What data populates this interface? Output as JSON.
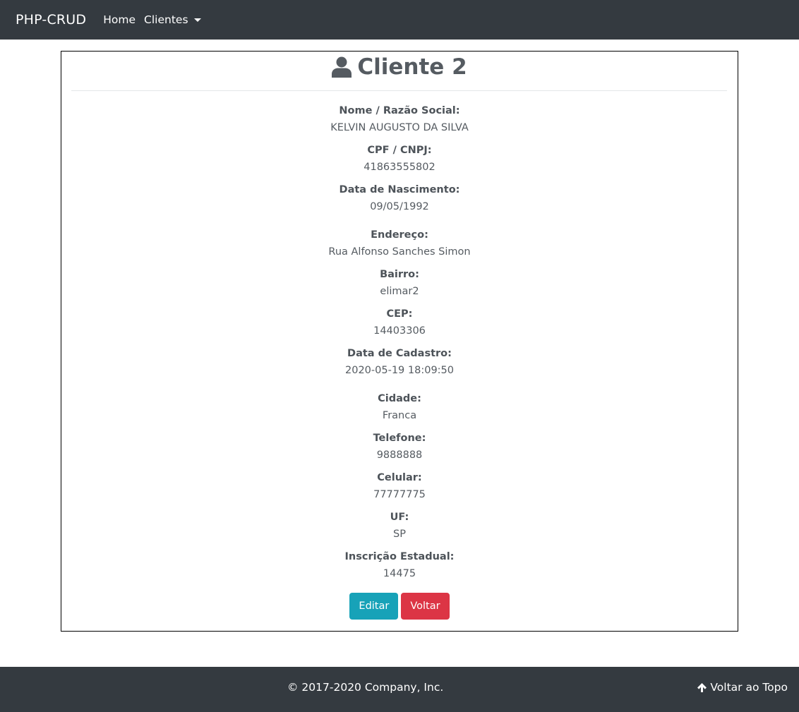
{
  "navbar": {
    "brand": "PHP-CRUD",
    "links": [
      {
        "label": "Home"
      },
      {
        "label": "Clientes"
      }
    ]
  },
  "card": {
    "title": "Cliente 2",
    "fields": [
      {
        "label": "Nome / Razão Social:",
        "value": "KELVIN AUGUSTO DA SILVA"
      },
      {
        "label": "CPF / CNPJ:",
        "value": "41863555802"
      },
      {
        "label": "Data de Nascimento:",
        "value": "09/05/1992"
      },
      {
        "label": "Endereço:",
        "value": "Rua Alfonso Sanches Simon"
      },
      {
        "label": "Bairro:",
        "value": "elimar2"
      },
      {
        "label": "CEP:",
        "value": "14403306"
      },
      {
        "label": "Data de Cadastro:",
        "value": "2020-05-19 18:09:50"
      },
      {
        "label": "Cidade:",
        "value": "Franca"
      },
      {
        "label": "Telefone:",
        "value": "9888888"
      },
      {
        "label": "Celular:",
        "value": "77777775"
      },
      {
        "label": "UF:",
        "value": "SP"
      },
      {
        "label": "Inscrição Estadual:",
        "value": "14475"
      }
    ],
    "buttons": {
      "edit": "Editar",
      "back": "Voltar"
    }
  },
  "footer": {
    "copyright": "© 2017-2020 Company, Inc.",
    "back_to_top": "Voltar ao Topo"
  },
  "colors": {
    "navbar_bg": "#343a40",
    "edit_button": "#17a2b8",
    "back_button": "#dc3545"
  },
  "icons": {
    "title": "user-icon",
    "back_to_top": "arrow-up-icon",
    "dropdown": "caret-down-icon"
  }
}
